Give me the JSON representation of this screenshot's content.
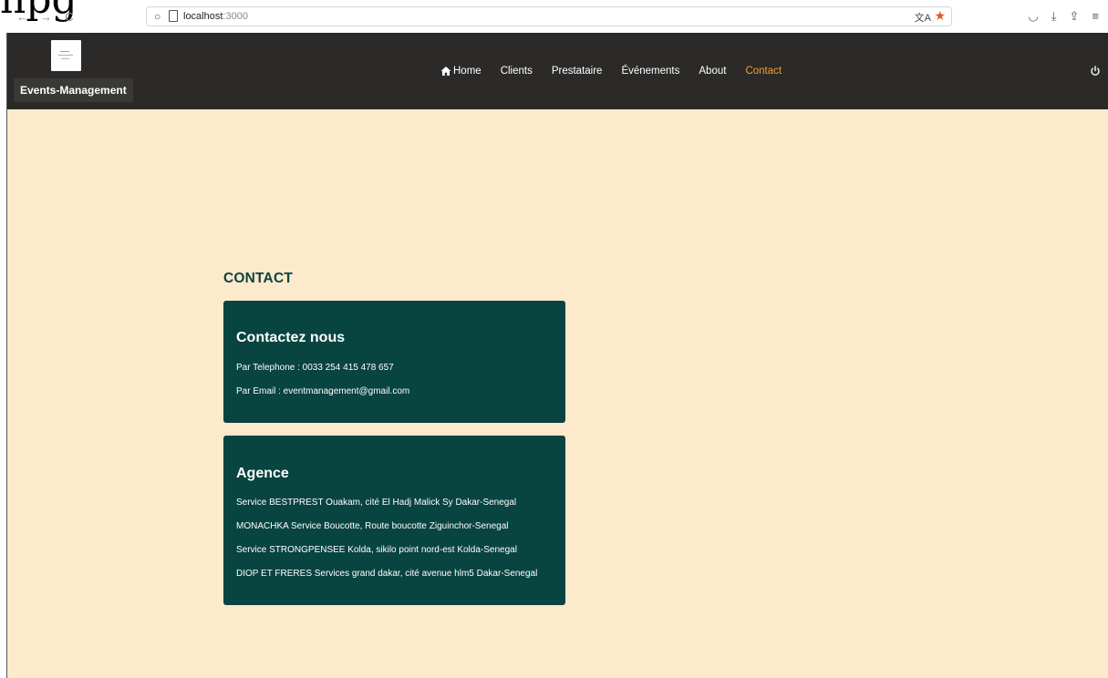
{
  "browser": {
    "page_title_fragment": "npg",
    "url_host": "localhost",
    "url_port": ":3000",
    "icons": {
      "back": "arrow-left-icon",
      "forward": "arrow-right-icon",
      "reload": "reload-icon",
      "shield": "shield-icon",
      "page": "page-icon",
      "translate": "translate-icon",
      "bookmark": "star-icon",
      "pocket": "pocket-icon",
      "download": "download-icon",
      "share": "share-icon",
      "menu": "hamburger-menu-icon"
    },
    "colors": {
      "bookmark_star": "#e25822"
    }
  },
  "header": {
    "brand": "Events-Management",
    "nav": [
      {
        "label": "Home",
        "icon": "home-icon"
      },
      {
        "label": "Clients"
      },
      {
        "label": "Prestataire"
      },
      {
        "label": "Événements"
      },
      {
        "label": "About"
      },
      {
        "label": "Contact",
        "active": true
      }
    ],
    "logout_icon": "power-icon",
    "colors": {
      "background": "#2b2a28",
      "active_link": "#f0a02a"
    }
  },
  "main": {
    "heading": "CONTACT",
    "contact_card": {
      "title": "Contactez nous",
      "lines": [
        "Par Telephone : 0033 254 415 478 657",
        "Par Email : eventmanagement@gmail.com"
      ]
    },
    "agence_card": {
      "title": "Agence",
      "lines": [
        "Service BESTPREST Ouakam, cité El Hadj Malick Sy Dakar-Senegal",
        "MONACHKA Service Boucotte, Route boucotte Ziguinchor-Senegal",
        "Service STRONGPENSEE Kolda, sikilo point nord-est Kolda-Senegal",
        "DIOP ET FRERES Services grand dakar, cité avenue hlm5 Dakar-Senegal"
      ]
    },
    "colors": {
      "page_background": "#fde9cc",
      "card_background": "#084440",
      "heading": "#0b4540"
    }
  }
}
